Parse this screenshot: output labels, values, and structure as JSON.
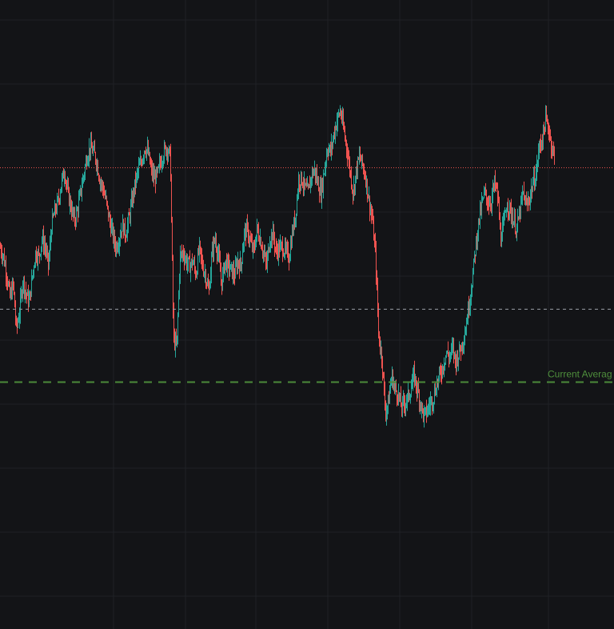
{
  "colors": {
    "background": "#131417",
    "grid": "#1f2126",
    "up": "#26a69a",
    "down": "#ef5350",
    "price_line": "#ef5350",
    "reference_line": "#9a9ea6",
    "average_line": "#4b8a3a",
    "average_label": "#4f8f3c"
  },
  "annotations": {
    "average_label": "Current Averag"
  },
  "chart_data": {
    "type": "line",
    "title": "",
    "xlabel": "",
    "ylabel": "",
    "grid": true,
    "ylim": [
      0,
      100
    ],
    "x": [
      0,
      4,
      8,
      12,
      16,
      20,
      24,
      28,
      32,
      36,
      40,
      44,
      48,
      52,
      56,
      60,
      64,
      68,
      72,
      76,
      80,
      84,
      88,
      92,
      96,
      100,
      104,
      108,
      112,
      116,
      120,
      124,
      128,
      132,
      136,
      140,
      144,
      148,
      152,
      156,
      160,
      164,
      168,
      172,
      176,
      180,
      184,
      188,
      192,
      196,
      200,
      204,
      208,
      212,
      216,
      220,
      224,
      228,
      232,
      236,
      240,
      244,
      248,
      252,
      256,
      260,
      264,
      268,
      272,
      276,
      280,
      284,
      288,
      292,
      296,
      300,
      304,
      308,
      312,
      316,
      320,
      324,
      328,
      332,
      336,
      340,
      344,
      348,
      352,
      356,
      360,
      364,
      368,
      372,
      376,
      380,
      384,
      388,
      392,
      396,
      400,
      404,
      408,
      412,
      416,
      420,
      424,
      428,
      432,
      436,
      440,
      444,
      448,
      452,
      456,
      460,
      464,
      468,
      472,
      476,
      480,
      484,
      488,
      492,
      496,
      500,
      504,
      508,
      512,
      516,
      520,
      524,
      528,
      532,
      536,
      540,
      544,
      548,
      552,
      556,
      560,
      564,
      568,
      572,
      576,
      580,
      584,
      588,
      592,
      596,
      600,
      604,
      608,
      612,
      616,
      620,
      624,
      628,
      632,
      636,
      640,
      644,
      648,
      652,
      656,
      660,
      664,
      668,
      672,
      676,
      680,
      684,
      688,
      692,
      696
    ],
    "series": [
      {
        "name": "",
        "values": [
          58,
          56,
          52,
          47,
          50,
          40,
          44,
          51,
          48,
          46,
          52,
          57,
          56,
          60,
          58,
          54,
          63,
          66,
          68,
          72,
          75,
          70,
          67,
          64,
          66,
          70,
          74,
          78,
          80,
          79,
          77,
          73,
          71,
          68,
          64,
          61,
          58,
          60,
          63,
          61,
          64,
          68,
          72,
          75,
          77,
          80,
          79,
          75,
          73,
          74,
          77,
          79,
          80,
          78,
          38,
          36,
          56,
          57,
          55,
          54,
          55,
          52,
          58,
          54,
          52,
          48,
          57,
          60,
          56,
          50,
          55,
          54,
          53,
          52,
          55,
          54,
          61,
          62,
          59,
          57,
          62,
          60,
          57,
          54,
          60,
          61,
          57,
          58,
          58,
          57,
          56,
          61,
          65,
          73,
          73,
          71,
          70,
          74,
          75,
          72,
          70,
          75,
          80,
          79,
          83,
          86,
          88,
          84,
          80,
          75,
          70,
          75,
          78,
          76,
          73,
          68,
          64,
          56,
          38,
          34,
          22,
          24,
          30,
          27,
          26,
          23,
          24,
          25,
          27,
          30,
          27,
          24,
          21,
          22,
          24,
          25,
          28,
          30,
          32,
          35,
          34,
          36,
          33,
          35,
          37,
          40,
          45,
          50,
          57,
          63,
          67,
          70,
          68,
          68,
          72,
          70,
          60,
          63,
          68,
          66,
          64,
          62,
          66,
          70,
          67,
          69,
          72,
          74,
          80,
          82,
          86,
          84,
          80,
          77
        ]
      }
    ],
    "reference_lines": [
      {
        "style": "dotted",
        "y": 75.5
      },
      {
        "style": "dashed",
        "y": 44.5
      },
      {
        "style": "dashed-bold",
        "y": 28.5
      }
    ]
  }
}
